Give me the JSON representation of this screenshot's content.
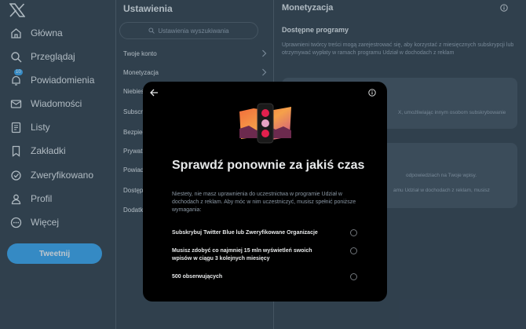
{
  "nav": {
    "items": [
      {
        "label": "Główna",
        "icon": "home-icon"
      },
      {
        "label": "Przeglądaj",
        "icon": "search-icon"
      },
      {
        "label": "Powiadomienia",
        "icon": "bell-icon",
        "badge": "10"
      },
      {
        "label": "Wiadomości",
        "icon": "mail-icon"
      },
      {
        "label": "Listy",
        "icon": "list-icon"
      },
      {
        "label": "Zakładki",
        "icon": "bookmark-icon"
      },
      {
        "label": "Zweryfikowano",
        "icon": "verified-icon"
      },
      {
        "label": "Profil",
        "icon": "profile-icon"
      },
      {
        "label": "Więcej",
        "icon": "more-icon"
      }
    ],
    "tweet_label": "Tweetnij"
  },
  "settings": {
    "title": "Ustawienia",
    "search_placeholder": "Ustawienia wyszukiwania",
    "rows": [
      "Twoje konto",
      "Monetyzacja",
      "Niebies",
      "Subscri",
      "Bezpiec",
      "Prywat",
      "Powiad",
      "Dostęp",
      "Dodatk"
    ]
  },
  "panel": {
    "title": "Monetyzacja",
    "section_title": "Dostępne programy",
    "description": "Uprawnieni twórcy treści mogą zarejestrować się, aby korzystać z miesięcznych subskrypcji lub otrzymywać wypłaty w ramach programu Udział w dochodach z reklam",
    "card1_fragment": "X, umożliwiając innym osobom subskrybowanie",
    "card2_fragment1": "odpowiedziach na Twoje wpisy.",
    "card2_fragment2": "amu Udział w dochodach z reklam, musisz"
  },
  "modal": {
    "title": "Sprawdź ponownie za jakiś czas",
    "text": "Niestety, nie masz uprawnienia do uczestnictwa w programie Udział w dochodach z reklam. Aby móc w nim uczestniczyć, musisz spełnić poniższe wymagania:",
    "requirements": [
      "Subskrybuj Twitter Blue lub Zweryfikowane Organizacje",
      "Musisz zdobyć co najmniej 15 mln wyświetleń swoich wpisów w ciągu 3 kolejnych miesięcy",
      "500 obserwujących"
    ]
  },
  "colors": {
    "background": "#15202b",
    "accent": "#1d9bf0",
    "modal_background": "#000000",
    "secondary_text": "#8b98a5"
  }
}
